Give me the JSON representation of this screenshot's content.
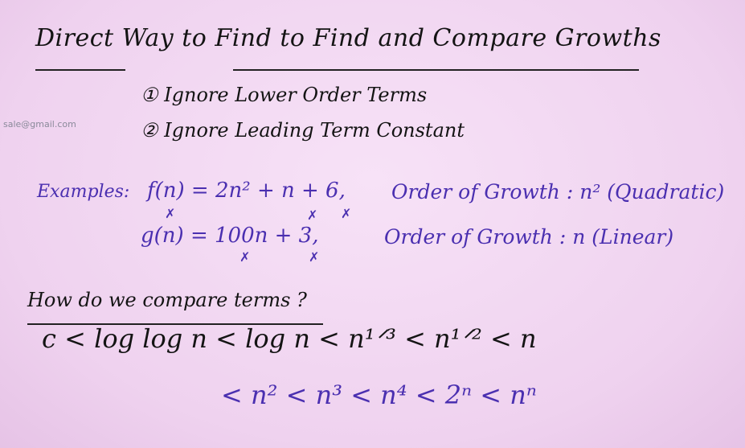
{
  "title": "Direct Way to Find to Find and Compare Growths",
  "watermark": "sale@gmail.com",
  "rules": [
    {
      "text": "① Ignore Lower Order Terms"
    },
    {
      "text": "② Ignore Leading Term Constant"
    }
  ],
  "examples": {
    "label": "Examples:",
    "items": [
      {
        "expr": "f(n) = 2n² + n + 6,",
        "growth": "Order of Growth : n² (Quadratic)"
      },
      {
        "expr": "g(n) = 100n + 3,",
        "growth": "Order of Growth : n (Linear)"
      }
    ]
  },
  "question": "How do we compare terms ?",
  "chain_line1": "c < log log n < log n < n¹ᐟ³ < n¹ᐟ² < n",
  "chain_line2": "< n² < n³ < n⁴ < 2ⁿ < nⁿ",
  "colors": {
    "ink_black": "#141414",
    "ink_purple": "#4a2fb0",
    "board": "#f3d9f3"
  }
}
